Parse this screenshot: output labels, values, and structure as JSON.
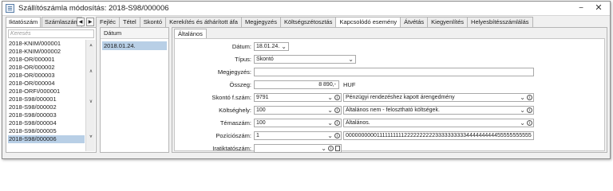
{
  "window": {
    "title": "Szállítószámla módosítás: 2018-S98/000006"
  },
  "left_tabs": [
    {
      "label": "Iktatószám"
    },
    {
      "label": "Számlaszám"
    }
  ],
  "top_tabs": [
    {
      "label": "Fejléc"
    },
    {
      "label": "Tétel"
    },
    {
      "label": "Skontó"
    },
    {
      "label": "Kerekítés és áthárított áfa"
    },
    {
      "label": "Megjegyzés"
    },
    {
      "label": "Költségszétosztás"
    },
    {
      "label": "Kapcsolódó esemény"
    },
    {
      "label": "Átvétás"
    },
    {
      "label": "Kiegyenlítés"
    },
    {
      "label": "Helyesbítésszámlálás"
    }
  ],
  "search": {
    "placeholder": "Keresés"
  },
  "list": [
    "2018-KNIM/000001",
    "2018-KNIM/000002",
    "2018-OR/000001",
    "2018-OR/000002",
    "2018-OR/000003",
    "2018-OR/000004",
    "2018-ORFI/000001",
    "2018-S98/000001",
    "2018-S98/000002",
    "2018-S98/000003",
    "2018-S98/000004",
    "2018-S98/000005",
    "2018-S98/000006"
  ],
  "date_panel": {
    "header": "Dátum",
    "row": "2018.01.24."
  },
  "form": {
    "tab": "Általános",
    "labels": {
      "datum": "Dátum:",
      "tipus": "Típus:",
      "megjegyzes": "Megjegyzés:",
      "osszeg": "Összeg:",
      "skonto": "Skontó f.szám:",
      "koltseghely": "Költséghely:",
      "temaszam": "Témaszám:",
      "pozicioszam": "Pozíciószám:",
      "iratiktatoszam": "Iratiktatószám:"
    },
    "values": {
      "datum": "18.01.24.",
      "tipus": "Skontó",
      "megjegyzes": "",
      "osszeg": "8 890,-",
      "currency": "HUF",
      "skonto_code": "9791",
      "skonto_desc": "Pénzügyi rendezéshez kapott árengedmény",
      "koltseghely_code": "100",
      "koltseghely_desc": "Általános nem - felosztható költségek.",
      "temaszam_code": "100",
      "temaszam_desc": "Általános.",
      "pozicioszam_code": "1",
      "pozicioszam_desc": "0000000000111111111122222222223333333333444444444455555555555",
      "iratiktatoszam": ""
    }
  }
}
